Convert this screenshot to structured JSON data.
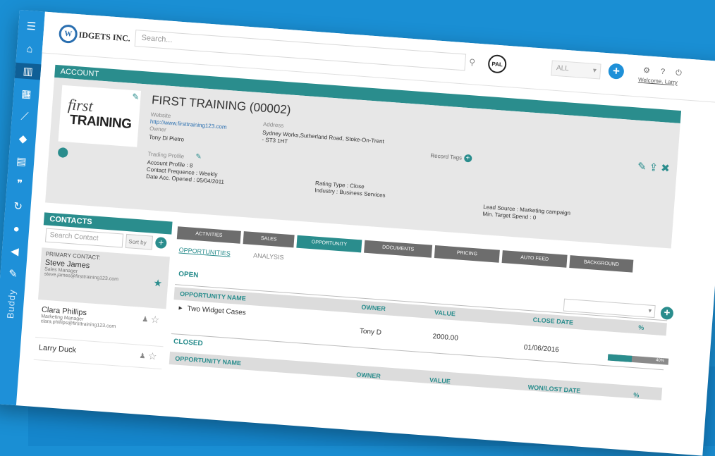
{
  "sidebar": {
    "icons": [
      "menu-icon",
      "home-icon",
      "building-icon",
      "calendar-icon",
      "chart-icon",
      "tag-icon",
      "calculator-icon",
      "quote-icon",
      "sync-icon",
      "user-icon",
      "megaphone-icon",
      "pencil-icon"
    ],
    "buddy_label": "Buddy"
  },
  "topbar": {
    "logo_mark": "W",
    "logo_text": "IDGETS INC.",
    "search_placeholder": "Search...",
    "pal_badge": "PAL",
    "scope_select": "ALL",
    "add_symbol": "+",
    "top_icons": "⚙ ? ⏻",
    "welcome_text": "Welcome, Larry"
  },
  "account": {
    "header": "ACCOUNT",
    "logo_first": "first",
    "logo_training": "TRAINING",
    "title": "FIRST TRAINING (00002)",
    "website_label": "Website",
    "website_value": "http://www.firsttraining123.com",
    "owner_label": "Owner",
    "owner_value": "Tony Di Pietro",
    "address_label": "Address",
    "address_value": "Sydney Works,Sutherland Road, Stoke-On-Trent",
    "address_line2": "- ST3 1HT",
    "record_tags_label": "Record Tags",
    "trading_profile_label": "Trading Profile",
    "account_profile": "Account Profile : 8",
    "contact_frequence": "Contact Frequence : Weekly",
    "date_opened": "Date Acc. Opened : 05/04/2011",
    "rating_type": "Rating Type : Close",
    "industry": "Industry : Business Services",
    "lead_source": "Lead Source : Marketing campaign",
    "min_target_spend": "Min. Target Spend : 0"
  },
  "contacts": {
    "header": "CONTACTS",
    "search_placeholder": "Search Contact",
    "sort_value": "Sort by",
    "primary_label": "PRIMARY CONTACT:",
    "items": [
      {
        "name": "Steve James",
        "role": "Sales Manager",
        "email": "steve.james@firsttraining123.com"
      },
      {
        "name": "Clara Phillips",
        "role": "Marketing Manager",
        "email": "clara.phillips@firsttraining123.com"
      },
      {
        "name": "Larry Duck",
        "role": "",
        "email": ""
      }
    ]
  },
  "tabs": [
    {
      "label": "ACTIVITIES",
      "w": 90
    },
    {
      "label": "SALES",
      "w": 72
    },
    {
      "label": "OPPORTUNITY",
      "w": 92
    },
    {
      "label": "DOCUMENTS",
      "w": 96
    },
    {
      "label": "PRICING",
      "w": 92
    },
    {
      "label": "AUTO FEED",
      "w": 92
    },
    {
      "label": "BACKGROUND",
      "w": 90
    }
  ],
  "subtabs": [
    "OPPORTUNITIES",
    "ANALYSIS"
  ],
  "opportunities": {
    "open_title": "OPEN",
    "closed_title": "CLOSED",
    "columns_open": [
      "OPPORTUNITY NAME",
      "OWNER",
      "VALUE",
      "CLOSE DATE",
      "%"
    ],
    "columns_closed": [
      "OPPORTUNITY NAME",
      "OWNER",
      "VALUE",
      "WON/LOST DATE",
      "%"
    ],
    "rows": [
      {
        "name": "Two Widget Cases",
        "owner": "Tony D",
        "value": "2000.00",
        "close_date": "01/06/2016",
        "percent": "40%",
        "progress": 0.4
      }
    ]
  }
}
